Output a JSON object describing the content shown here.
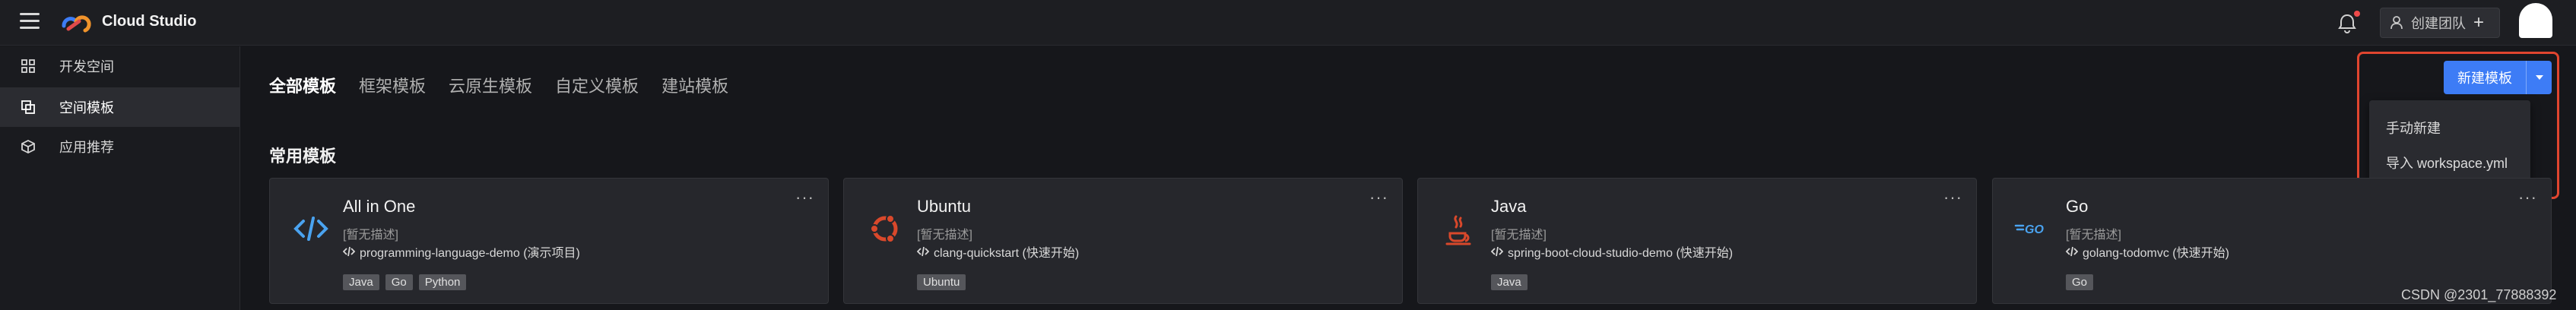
{
  "header": {
    "brand": "Cloud Studio",
    "team_button": "创建团队",
    "team_plus": "+"
  },
  "sidebar": {
    "items": [
      {
        "label": "开发空间",
        "icon": "grid-icon"
      },
      {
        "label": "空间模板",
        "icon": "copy-icon"
      },
      {
        "label": "应用推荐",
        "icon": "cube-icon"
      }
    ],
    "active": "空间模板"
  },
  "tabs": [
    "全部模板",
    "框架模板",
    "云原生模板",
    "自定义模板",
    "建站模板"
  ],
  "new_template": {
    "label": "新建模板",
    "menu": [
      "手动新建",
      "导入 workspace.yml"
    ]
  },
  "section_title": "常用模板",
  "cards": [
    {
      "title": "All in One",
      "desc": "[暂无描述]",
      "repo": "programming-language-demo (演示项目)",
      "tags": [
        "Java",
        "Go",
        "Python"
      ],
      "more": "···",
      "icon": "code-icon"
    },
    {
      "title": "Ubuntu",
      "desc": "[暂无描述]",
      "repo": "clang-quickstart (快速开始)",
      "tags": [
        "Ubuntu"
      ],
      "more": "···",
      "icon": "ubuntu-icon"
    },
    {
      "title": "Java",
      "desc": "[暂无描述]",
      "repo": "spring-boot-cloud-studio-demo (快速开始)",
      "tags": [
        "Java"
      ],
      "more": "···",
      "icon": "java-icon"
    },
    {
      "title": "Go",
      "desc": "[暂无描述]",
      "repo": "golang-todomvc (快速开始)",
      "tags": [
        "Go"
      ],
      "more": "···",
      "icon": "go-icon"
    }
  ],
  "watermark": "CSDN @2301_77888392",
  "colors": {
    "accent": "#3d7cf6",
    "highlight": "#e0452f",
    "background": "#16171b"
  }
}
